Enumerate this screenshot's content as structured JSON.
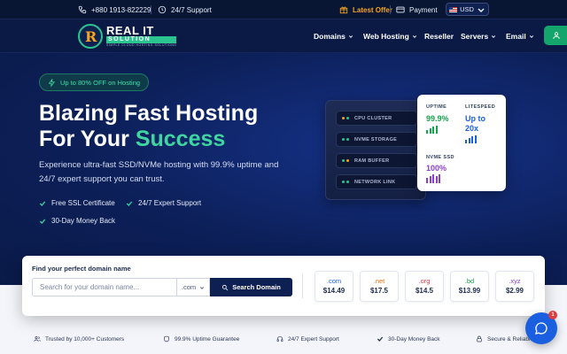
{
  "topbar": {
    "phone": "+880 1913-822229",
    "support": "24/7 Support",
    "offer": "Latest Offer",
    "payment": "Payment",
    "currency": "USD"
  },
  "nav": {
    "logo_line1": "REAL IT",
    "logo_line2": "SOLUTION",
    "logo_tagline": "SIMPLE CLOUD HOSTING SOLUTIONS",
    "items": [
      {
        "label": "Domains",
        "dropdown": true
      },
      {
        "label": "Web Hosting",
        "dropdown": true
      },
      {
        "label": "Reseller",
        "dropdown": false
      },
      {
        "label": "Servers",
        "dropdown": true
      },
      {
        "label": "Email",
        "dropdown": true
      }
    ]
  },
  "hero": {
    "badge": "Up to 80% OFF on Hosting",
    "title_line1": "Blazing Fast Hosting",
    "title_line2_prefix": "For Your ",
    "title_highlight": "Success",
    "description": "Experience ultra-fast SSD/NVMe hosting with 99.9% uptime and 24/7 expert support you can trust.",
    "features": [
      "Free SSL Certificate",
      "24/7 Expert Support",
      "30-Day Money Back"
    ]
  },
  "server_panel": {
    "racks": [
      {
        "label": "CPU CLUSTER",
        "led": "#f5a524"
      },
      {
        "label": "NVME STORAGE",
        "led": "#2bc38f"
      },
      {
        "label": "RAM BUFFER",
        "led": "#2bc38f"
      },
      {
        "label": "NETWORK LINK",
        "led": "#2bc38f"
      }
    ]
  },
  "stats": {
    "uptime_label": "UPTIME",
    "uptime_value": "99.9%",
    "speed_label": "LITESPEED",
    "speed_value": "Up to 20x",
    "storage_label": "NVME SSD",
    "storage_value": "100%"
  },
  "domain_search": {
    "title": "Find your perfect domain name",
    "placeholder": "Search for your domain name...",
    "tld_selected": ".com",
    "button": "Search Domain",
    "tlds": [
      {
        "name": ".com",
        "price": "$14.49",
        "color": "#1a5fe0"
      },
      {
        "name": ".net",
        "price": "$17.5",
        "color": "#e8711a"
      },
      {
        "name": ".org",
        "price": "$14.5",
        "color": "#e0384c"
      },
      {
        "name": ".bd",
        "price": "$13.99",
        "color": "#16a34a"
      },
      {
        "name": ".xyz",
        "price": "$2.99",
        "color": "#8b3fd0"
      }
    ]
  },
  "trust_bar": [
    "Trusted by 10,000+ Customers",
    "99.9% Uptime Guarantee",
    "24/7 Expert Support",
    "30-Day Money Back",
    "Secure & Reliable"
  ],
  "chat": {
    "badge": "1"
  },
  "colors": {
    "brand_green": "#2bc38f",
    "navy": "#0e1f52",
    "accent_orange": "#f5a524",
    "accent_blue": "#1a5fe0"
  }
}
